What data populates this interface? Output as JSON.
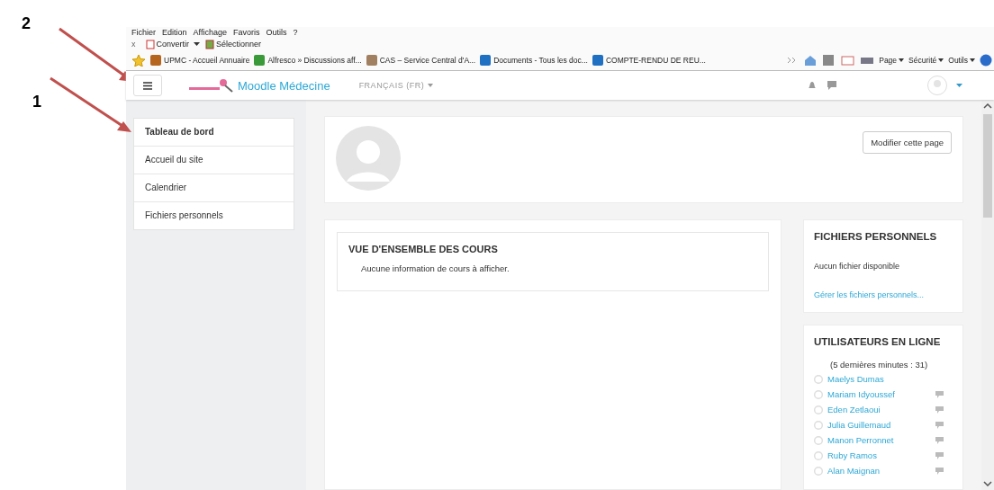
{
  "annotations": [
    {
      "label": "2"
    },
    {
      "label": "1"
    }
  ],
  "menu_bar": [
    "Fichier",
    "Edition",
    "Affichage",
    "Favoris",
    "Outils",
    "?"
  ],
  "toolbar": {
    "close": "x",
    "convert": "Convertir",
    "select": "Sélectionner"
  },
  "favorites": [
    {
      "label": "UPMC - Accueil Annuaire",
      "kind": "page"
    },
    {
      "label": "Alfresco » Discussions  aff...",
      "kind": "chart"
    },
    {
      "label": "CAS – Service Central d'A...",
      "kind": "cas"
    },
    {
      "label": "Documents - Tous les doc...",
      "kind": "sharepoint"
    },
    {
      "label": "COMPTE-RENDU DE REU...",
      "kind": "sharepoint"
    }
  ],
  "command_bar": [
    "Page",
    "Sécurité",
    "Outils"
  ],
  "navbar": {
    "site_name": "Moodle Médecine",
    "language": "FRANÇAIS (FR)"
  },
  "sidebar": {
    "items": [
      {
        "label": "Tableau de bord",
        "selected": true
      },
      {
        "label": "Accueil du site",
        "selected": false
      },
      {
        "label": "Calendrier",
        "selected": false
      },
      {
        "label": "Fichiers personnels",
        "selected": false
      }
    ]
  },
  "profile": {
    "edit_button": "Modifier cette page"
  },
  "course_overview": {
    "title": "VUE D'ENSEMBLE DES COURS",
    "message": "Aucune information de cours à afficher."
  },
  "private_files": {
    "title": "FICHIERS PERSONNELS",
    "message": "Aucun fichier disponible",
    "link": "Gérer les fichiers personnels..."
  },
  "online_users": {
    "title": "UTILISATEURS EN LIGNE",
    "subtitle": "(5 dernières minutes : 31)",
    "users": [
      {
        "name": "Maelys Dumas",
        "message_icon": false
      },
      {
        "name": "Mariam Idyoussef",
        "message_icon": true
      },
      {
        "name": "Eden Zetlaoui",
        "message_icon": true
      },
      {
        "name": "Julia Guillemaud",
        "message_icon": true
      },
      {
        "name": "Manon Perronnet",
        "message_icon": true
      },
      {
        "name": "Ruby Ramos",
        "message_icon": true
      },
      {
        "name": "Alan Maignan",
        "message_icon": true
      }
    ]
  }
}
